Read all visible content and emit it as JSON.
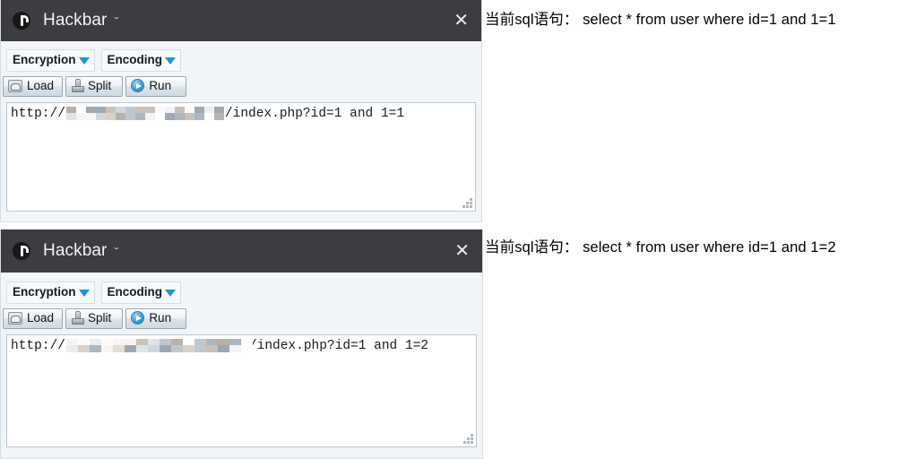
{
  "page": {
    "background": "#ffffff",
    "accent_blue": "#2196d6",
    "titlebar_bg": "#3c3c41",
    "panel_bg": "#f1f5f7"
  },
  "panels": [
    {
      "titlebar": {
        "logo_icon": "hackbar-logo-icon",
        "title": "Hackbar",
        "dropdown_caret": "ˇ",
        "close_label": "✕"
      },
      "dropdowns": [
        {
          "label": "Encryption",
          "caret_icon": "triangle-down-icon"
        },
        {
          "label": "Encoding",
          "caret_icon": "triangle-down-icon"
        }
      ],
      "buttons": [
        {
          "label": "Load",
          "icon": "archive-box-icon"
        },
        {
          "label": "Split",
          "icon": "split-tool-icon"
        },
        {
          "label": "Run",
          "icon": "play-circle-icon"
        }
      ],
      "url_field": {
        "prefix": "http://",
        "redacted": true,
        "suffix": "/index.php?id=1 and 1=1",
        "resize_grip_icon": "resize-grip-icon"
      }
    },
    {
      "titlebar": {
        "logo_icon": "hackbar-logo-icon",
        "title": "Hackbar",
        "dropdown_caret": "ˇ",
        "close_label": "✕"
      },
      "dropdowns": [
        {
          "label": "Encryption",
          "caret_icon": "triangle-down-icon"
        },
        {
          "label": "Encoding",
          "caret_icon": "triangle-down-icon"
        }
      ],
      "buttons": [
        {
          "label": "Load",
          "icon": "archive-box-icon"
        },
        {
          "label": "Split",
          "icon": "split-tool-icon"
        },
        {
          "label": "Run",
          "icon": "play-circle-icon"
        }
      ],
      "url_field": {
        "prefix": "http://",
        "redacted": true,
        "suffix": "/index.php?id=1 and 1=2",
        "resize_grip_icon": "resize-grip-icon"
      }
    }
  ],
  "sql_results": [
    {
      "text": "当前sql语句： select * from user where id=1 and 1=1"
    },
    {
      "text": "当前sql语句： select * from user where id=1 and 1=2"
    }
  ]
}
